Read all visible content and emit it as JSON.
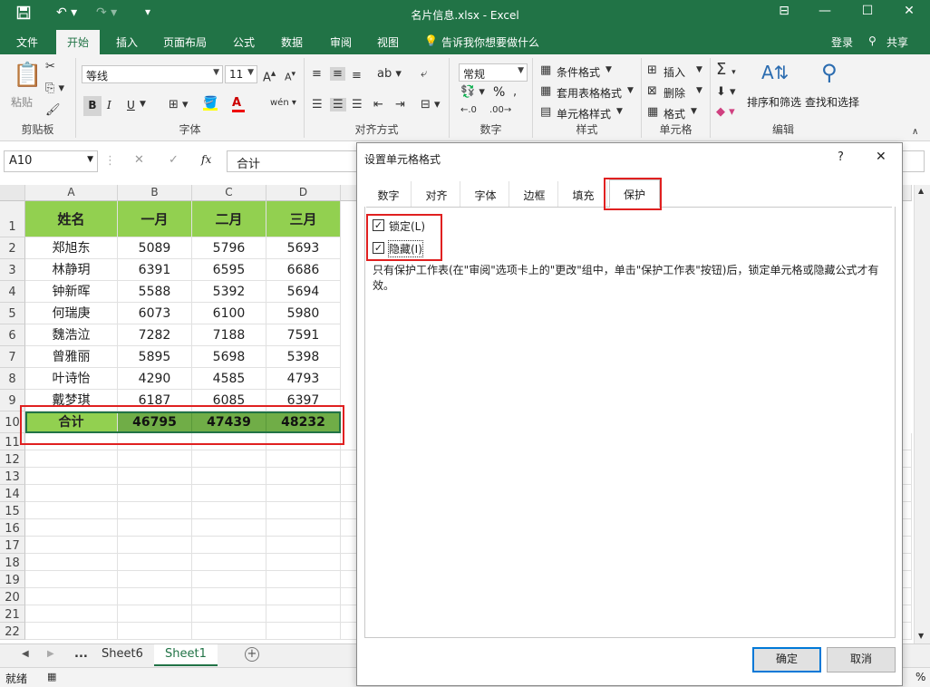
{
  "app": {
    "title": "名片信息.xlsx - Excel",
    "accent": "#217346"
  },
  "menu": {
    "file": "文件",
    "home": "开始",
    "insert": "插入",
    "layout": "页面布局",
    "formulas": "公式",
    "data": "数据",
    "review": "审阅",
    "view": "视图",
    "tell": "告诉我你想要做什么",
    "login": "登录",
    "share": "共享"
  },
  "ribbon": {
    "clipboard": {
      "paste": "粘贴",
      "label": "剪贴板"
    },
    "font": {
      "name": "等线",
      "size": "11",
      "label": "字体",
      "bold": "B",
      "italic": "I",
      "underline": "U"
    },
    "align": {
      "label": "对齐方式"
    },
    "number": {
      "format": "常规",
      "label": "数字",
      "percent": "%"
    },
    "styles": {
      "conditional": "条件格式",
      "table": "套用表格格式",
      "cell": "单元格样式",
      "label": "样式"
    },
    "cells": {
      "insert": "插入",
      "delete": "删除",
      "format": "格式",
      "label": "单元格"
    },
    "edit": {
      "sort": "排序和筛选",
      "find": "查找和选择",
      "label": "编辑"
    }
  },
  "formula_bar": {
    "cell_ref": "A10",
    "fx": "fx",
    "content": "合计"
  },
  "sheet": {
    "columns": [
      "A",
      "B",
      "C",
      "D"
    ],
    "header": [
      "姓名",
      "一月",
      "二月",
      "三月"
    ],
    "rows": [
      [
        "郑旭东",
        "5089",
        "5796",
        "5693"
      ],
      [
        "林静玥",
        "6391",
        "6595",
        "6686"
      ],
      [
        "钟新晖",
        "5588",
        "5392",
        "5694"
      ],
      [
        "何瑞庚",
        "6073",
        "6100",
        "5980"
      ],
      [
        "魏浩泣",
        "7282",
        "7188",
        "7591"
      ],
      [
        "曾雅丽",
        "5895",
        "5698",
        "5398"
      ],
      [
        "叶诗怡",
        "4290",
        "4585",
        "4793"
      ],
      [
        "戴梦琪",
        "6187",
        "6085",
        "6397"
      ]
    ],
    "total": [
      "合计",
      "46795",
      "47439",
      "48232"
    ],
    "row_numbers": [
      "1",
      "2",
      "3",
      "4",
      "5",
      "6",
      "7",
      "8",
      "9",
      "10",
      "11",
      "12",
      "13",
      "14",
      "15",
      "16",
      "17",
      "18",
      "19",
      "20",
      "21",
      "22"
    ]
  },
  "tabs": {
    "ellipsis": "...",
    "sheet6": "Sheet6",
    "sheet1": "Sheet1",
    "add": "+"
  },
  "status": {
    "ready": "就绪",
    "zoom_suffix": "%"
  },
  "dialog": {
    "title": "设置单元格格式",
    "help": "?",
    "close": "✕",
    "tabs": [
      "数字",
      "对齐",
      "字体",
      "边框",
      "填充",
      "保护"
    ],
    "active_tab": "保护",
    "locked_label": "锁定(L)",
    "locked_checked": true,
    "hidden_label": "隐藏(I)",
    "hidden_checked": true,
    "note": "只有保护工作表(在\"审阅\"选项卡上的\"更改\"组中，单击\"保护工作表\"按钮)后，锁定单元格或隐藏公式才有效。",
    "ok": "确定",
    "cancel": "取消"
  }
}
